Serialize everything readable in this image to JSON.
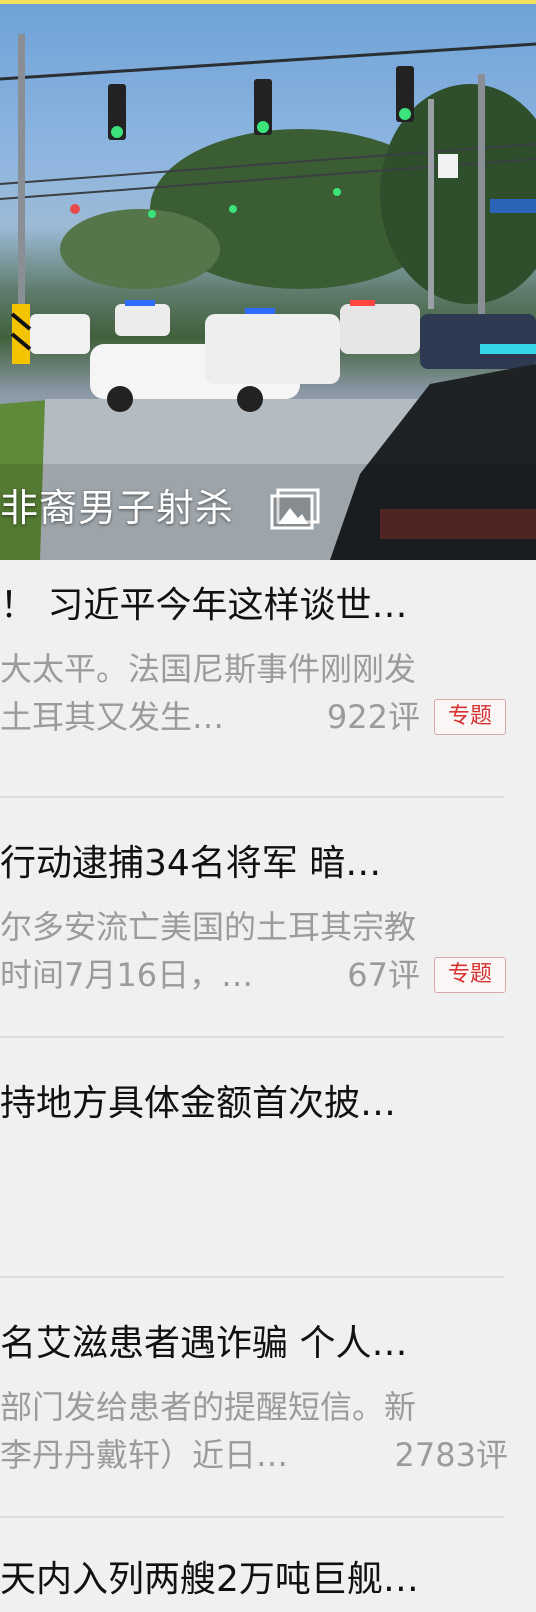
{
  "hero": {
    "caption": "非裔男子射杀",
    "gallery_icon": "gallery-icon"
  },
  "news": [
    {
      "title": "！ 习近平今年这样谈世…",
      "summary_line1": "大太平。法国尼斯事件刚刚发",
      "summary_line2": "土耳其又发生…",
      "comments": "922评",
      "badge": "专题"
    },
    {
      "title": "行动逮捕34名将军 暗…",
      "summary_line1": "尔多安流亡美国的土耳其宗教",
      "summary_line2": "时间7月16日，…",
      "comments": "67评",
      "badge": "专题"
    },
    {
      "title": "持地方具体金额首次披…"
    },
    {
      "title": "名艾滋患者遇诈骗 个人…",
      "summary_line1": "部门发给患者的提醒短信。新",
      "summary_line2": "李丹丹戴轩）近日…",
      "comments": "2783评"
    },
    {
      "title": "天内入列两艘2万吨巨舰…"
    }
  ],
  "colors": {
    "background": "#f0f0f0",
    "title": "#111111",
    "summary": "#9b9b9b",
    "badge_text": "#d73333",
    "top_accent": "#f5e05a"
  }
}
